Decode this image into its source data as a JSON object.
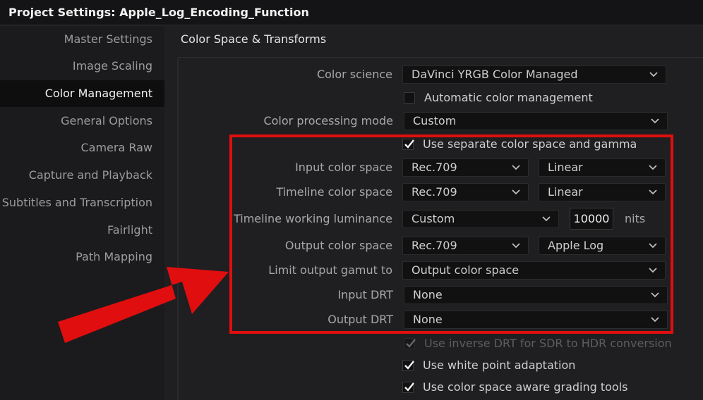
{
  "window": {
    "title": "Project Settings:  Apple_Log_Encoding_Function"
  },
  "sidebar": {
    "items": [
      {
        "label": "Master Settings"
      },
      {
        "label": "Image Scaling"
      },
      {
        "label": "Color Management",
        "active": true
      },
      {
        "label": "General Options"
      },
      {
        "label": "Camera Raw"
      },
      {
        "label": "Capture and Playback"
      },
      {
        "label": "Subtitles and Transcription"
      },
      {
        "label": "Fairlight"
      },
      {
        "label": "Path Mapping"
      }
    ]
  },
  "section": {
    "title": "Color Space & Transforms"
  },
  "settings": {
    "color_science": {
      "label": "Color science",
      "value": "DaVinci YRGB Color Managed"
    },
    "auto_color_mgmt": {
      "label": "Automatic color management",
      "checked": false
    },
    "processing_mode": {
      "label": "Color processing mode",
      "value": "Custom"
    },
    "separate_gamma": {
      "label": "Use separate color space and gamma",
      "checked": true
    },
    "input_color_space": {
      "label": "Input color space",
      "space": "Rec.709",
      "gamma": "Linear"
    },
    "timeline_color_space": {
      "label": "Timeline color space",
      "space": "Rec.709",
      "gamma": "Linear"
    },
    "timeline_luminance": {
      "label": "Timeline working luminance",
      "value": "Custom",
      "nits_value": "10000",
      "unit": "nits"
    },
    "output_color_space": {
      "label": "Output color space",
      "space": "Rec.709",
      "gamma": "Apple Log"
    },
    "limit_gamut": {
      "label": "Limit output gamut to",
      "value": "Output color space"
    },
    "input_drt": {
      "label": "Input DRT",
      "value": "None"
    },
    "output_drt": {
      "label": "Output DRT",
      "value": "None"
    },
    "inverse_drt": {
      "label": "Use inverse DRT for SDR to HDR conversion",
      "checked": true,
      "disabled": true
    },
    "white_point": {
      "label": "Use white point adaptation",
      "checked": true
    },
    "aware_tools": {
      "label": "Use color space aware grading tools",
      "checked": true
    }
  },
  "colors": {
    "annotation_red": "#e00e0e",
    "panel_bg": "#1f1f21",
    "field_bg": "#111112"
  }
}
